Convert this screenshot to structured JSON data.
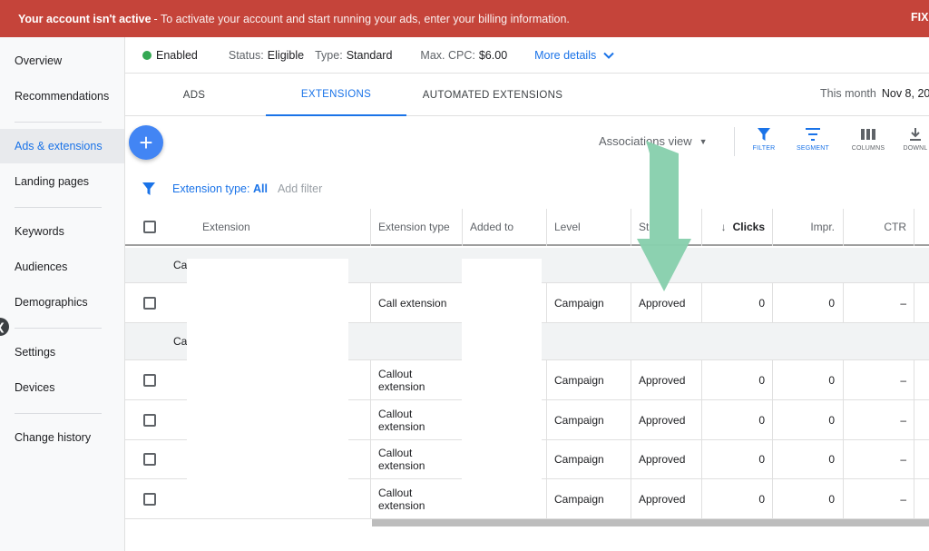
{
  "banner": {
    "bold": "Your account isn't active",
    "text": "- To activate your account and start running your ads, enter your billing information.",
    "fix": "FIX"
  },
  "sidebar": {
    "items": [
      {
        "label": "Overview"
      },
      {
        "label": "Recommendations"
      },
      {
        "label": "Ads & extensions",
        "active": true
      },
      {
        "label": "Landing pages"
      },
      {
        "label": "Keywords"
      },
      {
        "label": "Audiences"
      },
      {
        "label": "Demographics"
      },
      {
        "label": "Settings"
      },
      {
        "label": "Devices"
      },
      {
        "label": "Change history"
      }
    ],
    "collapse_icon": "chevron-left-icon"
  },
  "status": {
    "enabled": "Enabled",
    "status_label": "Status:",
    "status_value": "Eligible",
    "type_label": "Type:",
    "type_value": "Standard",
    "cpc_label": "Max. CPC:",
    "cpc_value": "$6.00",
    "more_details": "More details"
  },
  "tabs": [
    {
      "label": "ADS"
    },
    {
      "label": "EXTENSIONS",
      "active": true
    },
    {
      "label": "AUTOMATED EXTENSIONS"
    }
  ],
  "daterange": {
    "label": "This month",
    "value": "Nov 8, 20"
  },
  "toolbar": {
    "add_label": "+",
    "view": "Associations view",
    "filter": "FILTER",
    "segment": "SEGMENT",
    "columns": "COLUMNS",
    "download": "DOWNL"
  },
  "filter": {
    "type_label": "Extension type:",
    "type_value": "All",
    "add_filter": "Add filter"
  },
  "table": {
    "headers": {
      "extension": "Extension",
      "type": "Extension type",
      "added_to": "Added to",
      "level": "Level",
      "status": "St",
      "clicks": "Clicks",
      "impr": "Impr.",
      "ctr": "CTR"
    },
    "groups": [
      "Ca",
      "Ca"
    ],
    "rows": [
      {
        "type": "Call extension",
        "level": "Campaign",
        "status": "Approved",
        "clicks": "0",
        "impr": "0",
        "ctr": "–"
      },
      {
        "type": "Callout extension",
        "level": "Campaign",
        "status": "Approved",
        "clicks": "0",
        "impr": "0",
        "ctr": "–"
      },
      {
        "type": "Callout extension",
        "level": "Campaign",
        "status": "Approved",
        "clicks": "0",
        "impr": "0",
        "ctr": "–"
      },
      {
        "type": "Callout extension",
        "level": "Campaign",
        "status": "Approved",
        "clicks": "0",
        "impr": "0",
        "ctr": "–"
      },
      {
        "type": "Callout extension",
        "level": "Campaign",
        "status": "Approved",
        "clicks": "0",
        "impr": "0",
        "ctr": "–"
      }
    ]
  },
  "colors": {
    "banner": "#c5443a",
    "accent": "#1a73e8",
    "enabled_dot": "#34a853",
    "annotation_arrow": "#88cfad"
  }
}
